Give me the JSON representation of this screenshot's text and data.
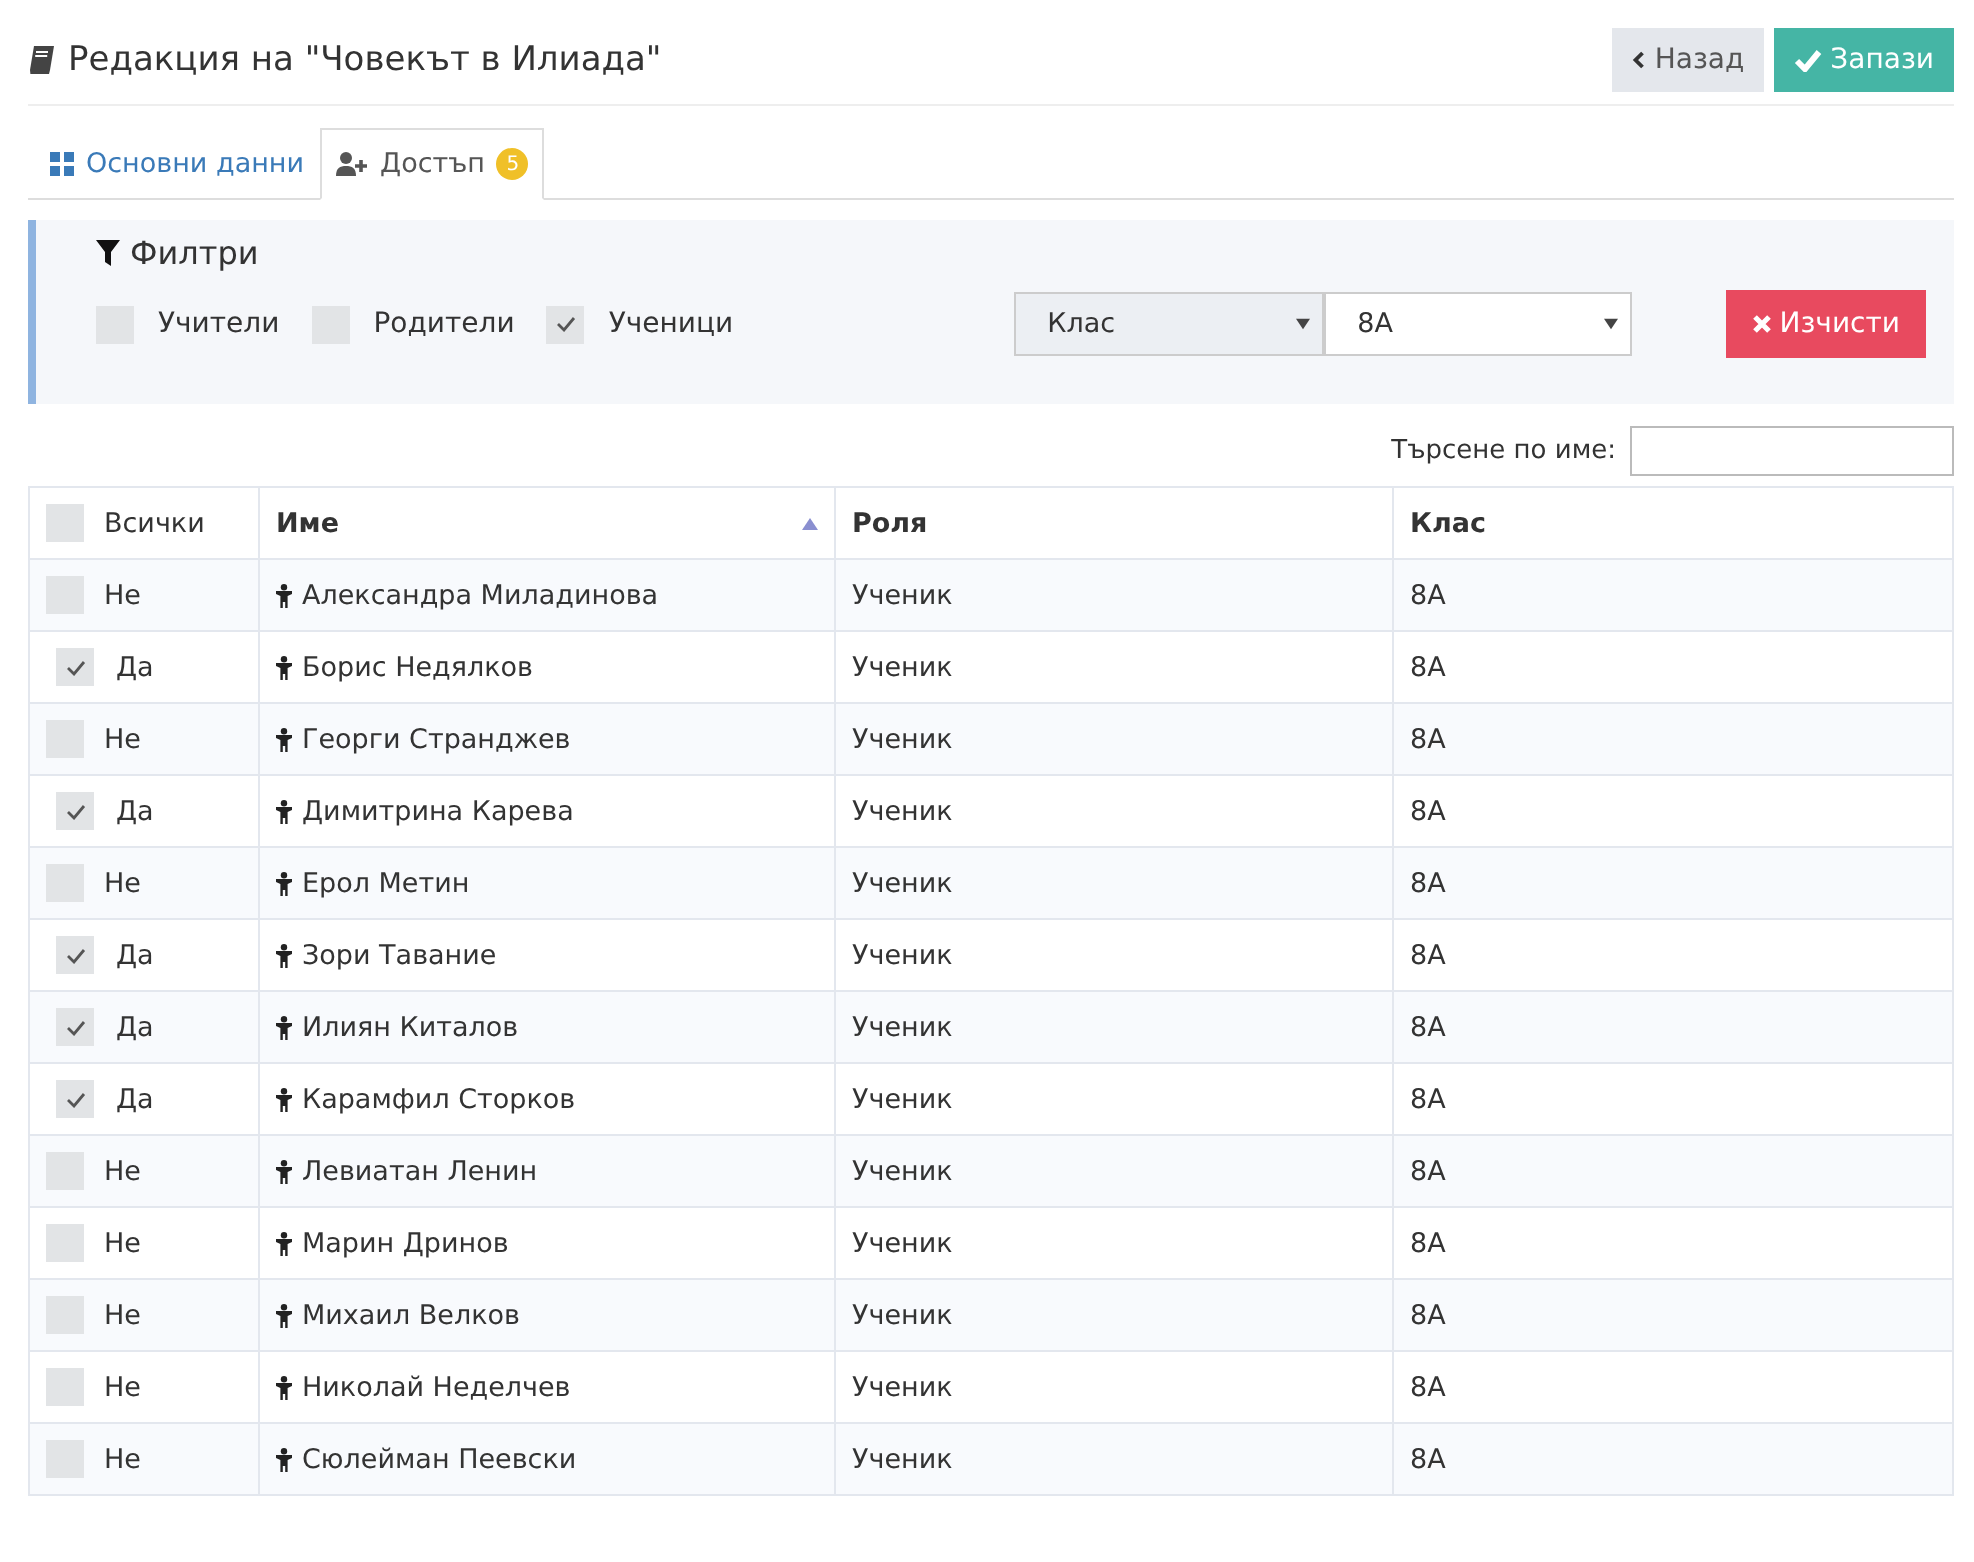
{
  "header": {
    "title": "Редакция на \"Човекът в Илиада\"",
    "buttons": [
      {
        "kind": "back",
        "label": "Назад"
      },
      {
        "kind": "save",
        "label": "Запази"
      }
    ]
  },
  "tabs": [
    {
      "label": "Основни данни",
      "selected": false,
      "kind": "grid"
    },
    {
      "label": "Достъп",
      "selected": true,
      "kind": "users",
      "badge": "5"
    }
  ],
  "filters": {
    "title": "Филтри",
    "checks": [
      {
        "label": "Учители",
        "checked": false
      },
      {
        "label": "Родители",
        "checked": false
      },
      {
        "label": "Ученици",
        "checked": true
      }
    ],
    "select_type": "Клас",
    "select_value": "8А",
    "clear_button": "Изчисти"
  },
  "search": {
    "label": "Търсене по име:"
  },
  "table": {
    "columns": [
      "Всички",
      "Име",
      "Роля",
      "Клас"
    ],
    "all_checked": false,
    "rows": [
      {
        "checked": false,
        "access": "Не",
        "name": "Александра Миладинова",
        "role": "Ученик",
        "class": "8А"
      },
      {
        "checked": true,
        "access": "Да",
        "name": "Борис Недялков",
        "role": "Ученик",
        "class": "8А"
      },
      {
        "checked": false,
        "access": "Не",
        "name": "Георги Странджев",
        "role": "Ученик",
        "class": "8А"
      },
      {
        "checked": true,
        "access": "Да",
        "name": "Димитрина Карева",
        "role": "Ученик",
        "class": "8А"
      },
      {
        "checked": false,
        "access": "Не",
        "name": "Ерол Метин",
        "role": "Ученик",
        "class": "8А"
      },
      {
        "checked": true,
        "access": "Да",
        "name": "Зори Тавание",
        "role": "Ученик",
        "class": "8А"
      },
      {
        "checked": true,
        "access": "Да",
        "name": "Илиян Киталов",
        "role": "Ученик",
        "class": "8А"
      },
      {
        "checked": true,
        "access": "Да",
        "name": "Карамфил Сторков",
        "role": "Ученик",
        "class": "8А"
      },
      {
        "checked": false,
        "access": "Не",
        "name": "Левиатан Ленин",
        "role": "Ученик",
        "class": "8А"
      },
      {
        "checked": false,
        "access": "Не",
        "name": "Марин Дринов",
        "role": "Ученик",
        "class": "8А"
      },
      {
        "checked": false,
        "access": "Не",
        "name": "Михаил Велков",
        "role": "Ученик",
        "class": "8А"
      },
      {
        "checked": false,
        "access": "Не",
        "name": "Николай Неделчев",
        "role": "Ученик",
        "class": "8А"
      },
      {
        "checked": false,
        "access": "Не",
        "name": "Сюлейман Пеевски",
        "role": "Ученик",
        "class": "8А"
      }
    ]
  }
}
